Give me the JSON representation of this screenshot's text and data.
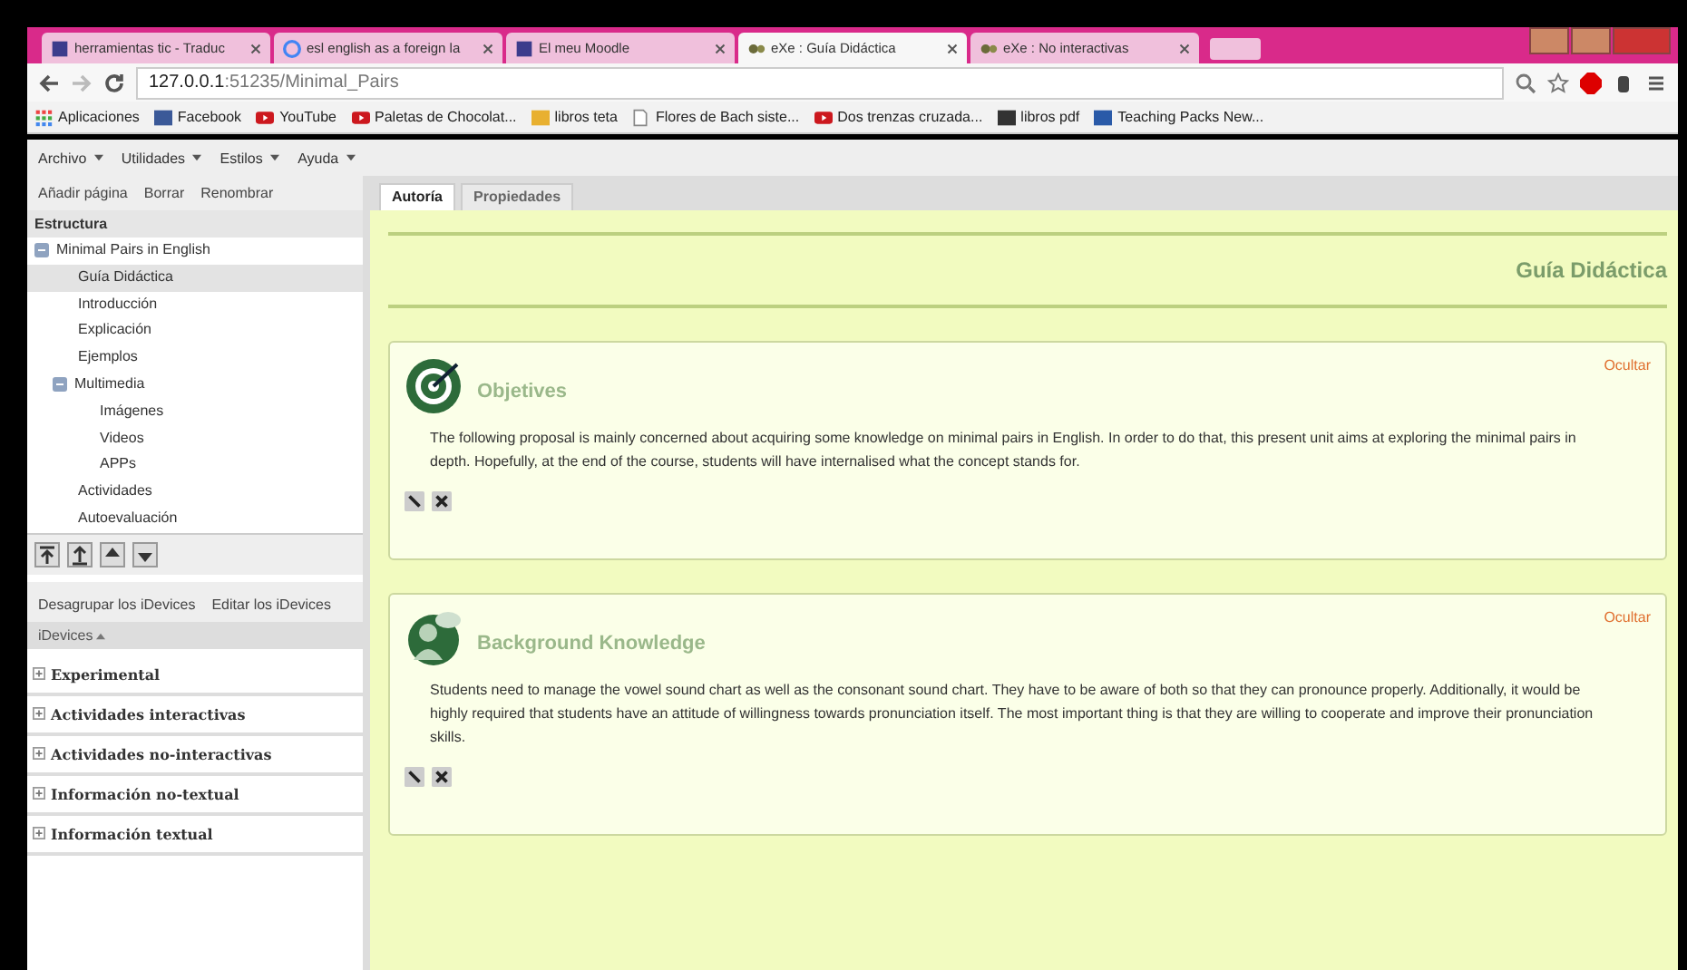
{
  "browser_tabs": [
    {
      "title": "herramientas tic - Traduc",
      "selected": false
    },
    {
      "title": "esl english as a foreign la",
      "selected": false
    },
    {
      "title": "El meu Moodle",
      "selected": false
    },
    {
      "title": "eXe : Guía Didáctica",
      "selected": true
    },
    {
      "title": "eXe : No interactivas",
      "selected": false
    }
  ],
  "address": {
    "host": "127.0.0.1",
    "rest": ":51235/Minimal_Pairs"
  },
  "bookmarks": [
    "Aplicaciones",
    "Facebook",
    "YouTube",
    "Paletas de Chocolat...",
    "libros teta",
    "Flores de Bach siste...",
    "Dos trenzas cruzada...",
    "libros pdf",
    "Teaching Packs New..."
  ],
  "menu": [
    "Archivo",
    "Utilidades",
    "Estilos",
    "Ayuda"
  ],
  "sidebar": {
    "actions": [
      "Añadir página",
      "Borrar",
      "Renombrar"
    ],
    "structure_title": "Estructura",
    "tree": [
      {
        "label": "Minimal Pairs in English",
        "selected": false,
        "expanded": true,
        "children": [
          {
            "label": "Guía Didáctica",
            "selected": true
          },
          {
            "label": "Introducción",
            "selected": false
          },
          {
            "label": "Explicación",
            "selected": false
          },
          {
            "label": "Ejemplos",
            "selected": false
          },
          {
            "label": "Multimedia",
            "selected": false,
            "expanded": true,
            "children": [
              {
                "label": "Imágenes",
                "selected": false
              },
              {
                "label": "Videos",
                "selected": false
              },
              {
                "label": "APPs",
                "selected": false
              }
            ]
          },
          {
            "label": "Actividades",
            "selected": false
          },
          {
            "label": "Autoevaluación",
            "selected": false
          }
        ]
      }
    ],
    "idevice_actions": [
      "Desagrupar los iDevices",
      "Editar los iDevices"
    ],
    "idevices_header": "iDevices",
    "categories": [
      "Experimental",
      "Actividades interactivas",
      "Actividades no-interactivas",
      "Información no-textual",
      "Información textual"
    ]
  },
  "content_tabs": [
    {
      "label": "Autoría",
      "selected": true
    },
    {
      "label": "Propiedades",
      "selected": false
    }
  ],
  "page_title": "Guía Didáctica",
  "idevices": [
    {
      "title": "Objetives",
      "hide_link": "Ocultar",
      "text": "The following proposal is mainly concerned about acquiring some knowledge on minimal pairs in English.  In order to do that, this present unit aims at exploring the minimal pairs in depth. Hopefully, at the end of the course, students will have internalised what the concept stands for."
    },
    {
      "title": "Background Knowledge",
      "hide_link": "Ocultar",
      "text": "Students need to manage the vowel sound chart as well as the consonant sound chart. They  have to be aware of both so that they can pronounce properly. Additionally, it would be highly required that students have an attitude of willingness towards pronunciation itself. The most important thing is that they are willing to cooperate and improve their pronunciation skills."
    }
  ]
}
